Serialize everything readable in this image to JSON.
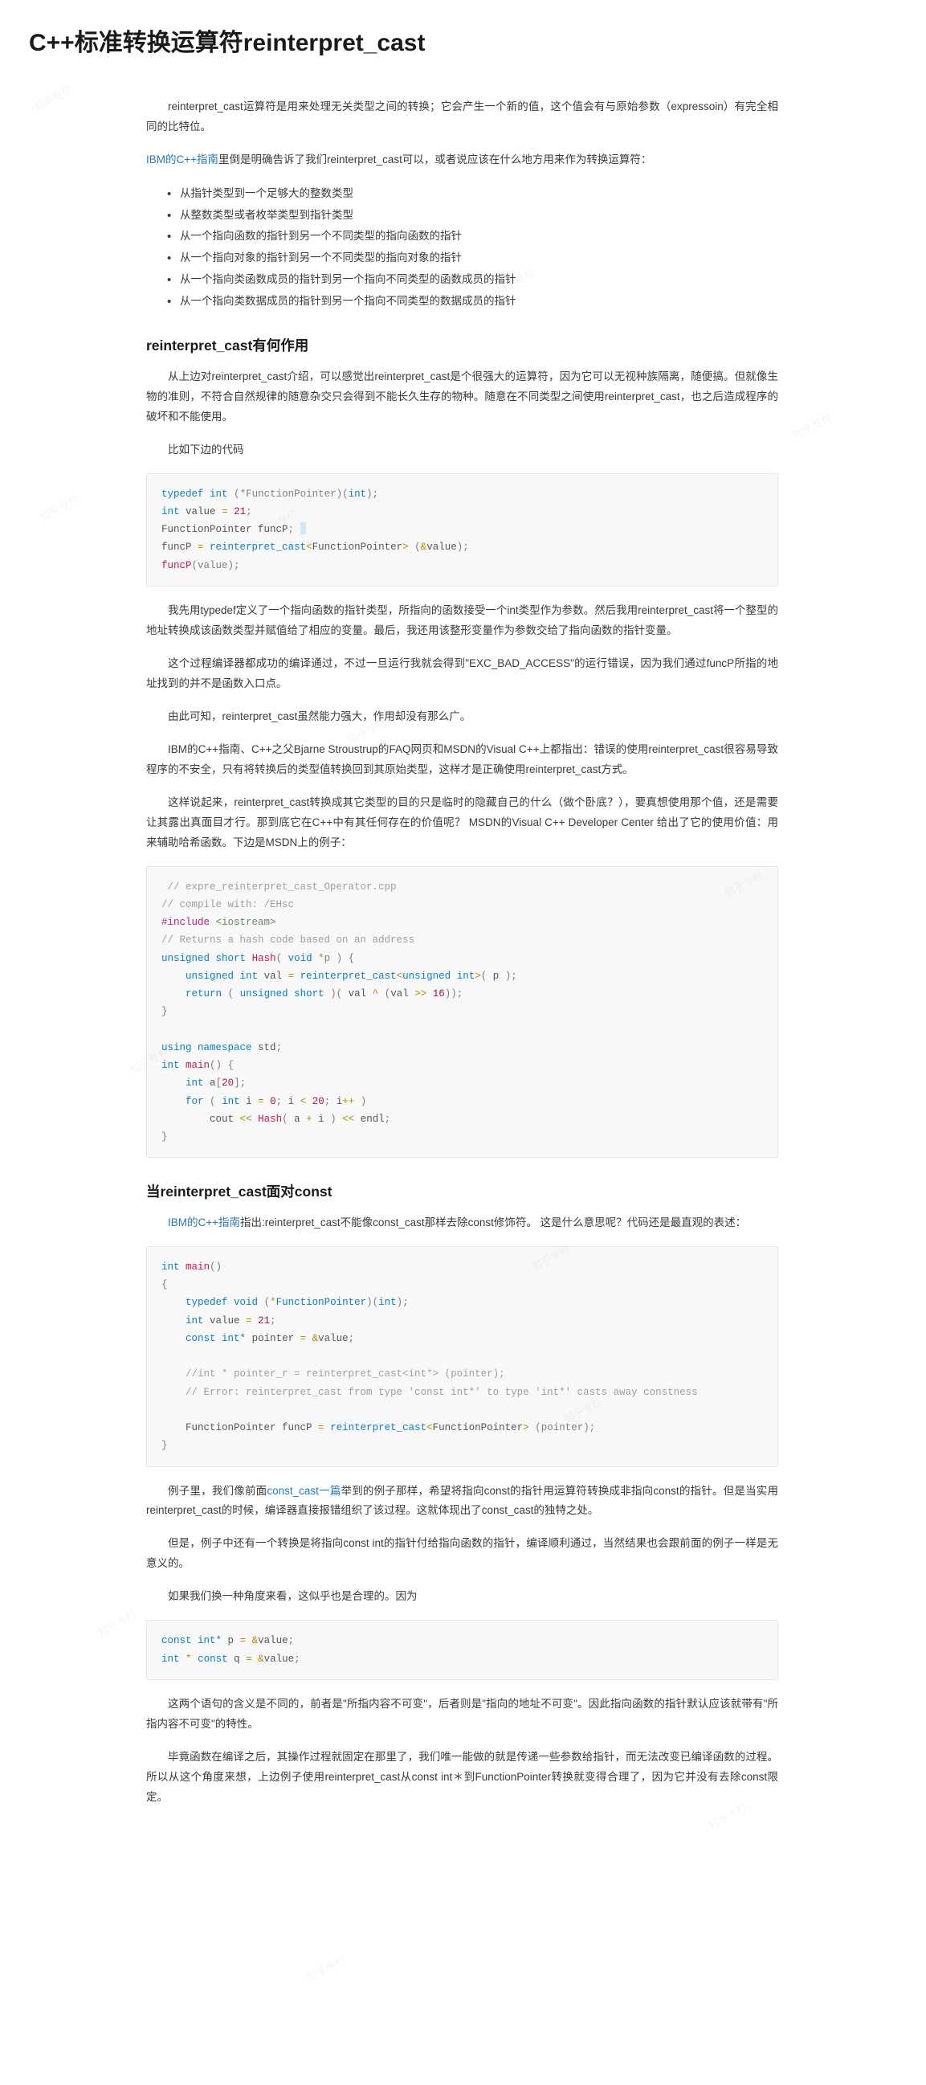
{
  "document": {
    "title": "C++标准转换运算符reinterpret_cast",
    "watermark": "知乎专栏"
  },
  "intro": {
    "paragraph": "reinterpret_cast运算符是用来处理无关类型之间的转换；它会产生一个新的值，这个值会有与原始参数（expressoin）有完全相同的比特位。",
    "lead_link": "IBM的C++指南",
    "lead_rest": "里倒是明确告诉了我们reinterpret_cast可以，或者说应该在什么地方用来作为转换运算符：",
    "bullets": [
      "从指针类型到一个足够大的整数类型",
      "从整数类型或者枚举类型到指针类型",
      "从一个指向函数的指针到另一个不同类型的指向函数的指针",
      "从一个指向对象的指针到另一个不同类型的指向对象的指针",
      "从一个指向类函数成员的指针到另一个指向不同类型的函数成员的指针",
      "从一个指向类数据成员的指针到另一个指向不同类型的数据成员的指针"
    ]
  },
  "section_role": {
    "heading": "reinterpret_cast有何作用",
    "p1": "从上边对reinterpret_cast介绍，可以感觉出reinterpret_cast是个很强大的运算符，因为它可以无视种族隔离，随便搞。但就像生物的准则，不符合自然规律的随意杂交只会得到不能长久生存的物种。随意在不同类型之间使用reinterpret_cast，也之后造成程序的破坏和不能使用。",
    "p2": "比如下边的代码",
    "code1": {
      "lines": [
        "typedef int (*FunctionPointer)(int);",
        "int value = 21;",
        "FunctionPointer funcP;",
        "funcP = reinterpret_cast<FunctionPointer> (&value);",
        "funcP(value);"
      ]
    },
    "p3": "我先用typedef定义了一个指向函数的指针类型，所指向的函数接受一个int类型作为参数。然后我用reinterpret_cast将一个整型的地址转换成该函数类型并赋值给了相应的变量。最后，我还用该整形变量作为参数交给了指向函数的指针变量。",
    "p4": "这个过程编译器都成功的编译通过，不过一旦运行我就会得到\"EXC_BAD_ACCESS\"的运行错误，因为我们通过funcP所指的地址找到的并不是函数入口点。",
    "p5": "由此可知，reinterpret_cast虽然能力强大，作用却没有那么广。",
    "p6": "IBM的C++指南、C++之父Bjarne Stroustrup的FAQ网页和MSDN的Visual C++上都指出：错误的使用reinterpret_cast很容易导致程序的不安全，只有将转换后的类型值转换回到其原始类型，这样才是正确使用reinterpret_cast方式。",
    "p7": "这样说起来，reinterpret_cast转换成其它类型的目的只是临时的隐藏自己的什么（做个卧底？），要真想使用那个值，还是需要让其露出真面目才行。那到底它在C++中有其任何存在的价值呢？ MSDN的Visual C++ Developer Center 给出了它的使用价值：用来辅助哈希函数。下边是MSDN上的例子：",
    "code2": {
      "lines": [
        " // expre_reinterpret_cast_Operator.cpp",
        "// compile with: /EHsc",
        "#include <iostream>",
        "// Returns a hash code based on an address",
        "unsigned short Hash( void *p ) {",
        "    unsigned int val = reinterpret_cast<unsigned int>( p );",
        "    return ( unsigned short )( val ^ (val >> 16));",
        "}",
        "",
        "using namespace std;",
        "int main() {",
        "    int a[20];",
        "    for ( int i = 0; i < 20; i++ )",
        "        cout << Hash( a + i ) << endl;",
        "}"
      ]
    }
  },
  "section_const": {
    "heading": "当reinterpret_cast面对const",
    "p1_link": "IBM的C++指南",
    "p1_rest": "指出:reinterpret_cast不能像const_cast那样去除const修饰符。 这是什么意思呢？代码还是最直观的表述：",
    "code3": {
      "lines": [
        "int main()",
        "{",
        "    typedef void (*FunctionPointer)(int);",
        "    int value = 21;",
        "    const int* pointer = &value;",
        "",
        "    //int * pointer_r = reinterpret_cast<int*> (pointer);",
        "    // Error: reinterpret_cast from type 'const int*' to type 'int*' casts away constness",
        "",
        "    FunctionPointer funcP = reinterpret_cast<FunctionPointer> (pointer);",
        "}"
      ]
    },
    "p2_pre": "例子里，我们像前面",
    "p2_link": "const_cast一篇",
    "p2_rest": "举到的例子那样，希望将指向const的指针用运算符转换成非指向const的指针。但是当实用reinterpret_cast的时候，编译器直接报错组织了该过程。这就体现出了const_cast的独特之处。",
    "p3": "但是，例子中还有一个转换是将指向const int的指针付给指向函数的指针，编译顺利通过，当然结果也会跟前面的例子一样是无意义的。",
    "p4": "如果我们换一种角度来看，这似乎也是合理的。因为",
    "code4": {
      "lines": [
        "const int* p = &value;",
        "int * const q = &value;"
      ]
    },
    "p5": "这两个语句的含义是不同的，前者是\"所指内容不可变\"，后者则是\"指向的地址不可变\"。因此指向函数的指针默认应该就带有\"所指内容不可变\"的特性。",
    "p6": "毕竟函数在编译之后，其操作过程就固定在那里了，我们唯一能做的就是传递一些参数给指针，而无法改变已编译函数的过程。所以从这个角度来想，上边例子使用reinterpret_cast从const int＊到FunctionPointer转换就变得合理了，因为它并没有去除const限定。"
  }
}
